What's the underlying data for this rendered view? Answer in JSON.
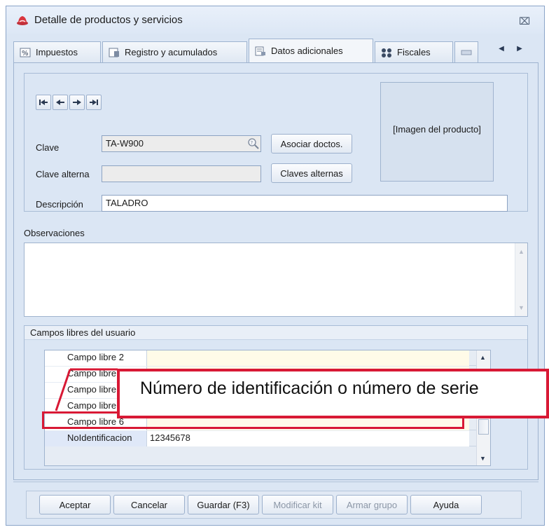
{
  "window": {
    "title": "Detalle de productos y servicios",
    "close_glyph": "⌧",
    "icon": "app-red-hat-icon"
  },
  "tabs": [
    {
      "label": "Impuestos",
      "icon": "percent-icon",
      "active": false
    },
    {
      "label": "Registro y acumulados",
      "icon": "ledger-icon",
      "active": false
    },
    {
      "label": "Datos adicionales",
      "icon": "form-icon",
      "active": true
    },
    {
      "label": "Fiscales",
      "icon": "grid-dots-icon",
      "active": false
    },
    {
      "label": "",
      "icon": "tab-overflow-icon",
      "active": false
    }
  ],
  "tab_arrows": {
    "left": "◀",
    "right": "▶"
  },
  "navigation": [
    "first-record-icon",
    "previous-record-icon",
    "next-record-icon",
    "last-record-icon"
  ],
  "form": {
    "clave_label": "Clave",
    "clave_value": "TA-W900",
    "clave_alterna_label": "Clave alterna",
    "clave_alterna_value": "",
    "descripcion_label": "Descripción",
    "descripcion_value": "TALADRO",
    "asociar_button": "Asociar doctos.",
    "claves_alternas_button": "Claves alternas",
    "image_placeholder": "[Imagen del producto]"
  },
  "observaciones": {
    "label": "Observaciones",
    "value": ""
  },
  "campos_libres": {
    "title": "Campos libres del usuario",
    "rows": [
      {
        "key": "Campo libre 2",
        "value": ""
      },
      {
        "key": "Campo libre 3",
        "value": ""
      },
      {
        "key": "Campo libre 4",
        "value": ""
      },
      {
        "key": "Campo libre 5",
        "value": ""
      },
      {
        "key": "Campo libre 6",
        "value": ""
      },
      {
        "key": "NoIdentificacion",
        "value": "12345678"
      }
    ]
  },
  "callout": {
    "text": "Número de identificación o número de serie"
  },
  "buttons": {
    "aceptar": "Aceptar",
    "cancelar": "Cancelar",
    "guardar": "Guardar (F3)",
    "modificar_kit": "Modificar kit",
    "armar_grupo": "Armar grupo",
    "ayuda": "Ayuda"
  },
  "colors": {
    "highlight_red": "#d81935",
    "panel_blue": "#dbe6f4"
  }
}
